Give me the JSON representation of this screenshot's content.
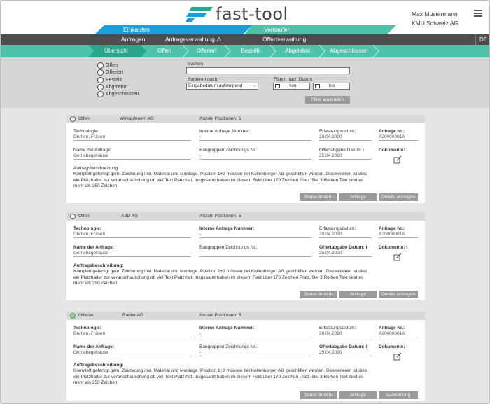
{
  "brand": {
    "logo_text": "fast-tool",
    "accent": "#2aa78b",
    "blue": "#1ba0dc"
  },
  "user": {
    "name": "Max Mustermann",
    "company": "KMU Schweiz AG"
  },
  "sections": {
    "einkaufen": "Einkaufen",
    "verkaufen": "Verkaufen",
    "anfragen": "Anfragen",
    "anfrageverwaltung": "Anfrageverwaltung",
    "offertverwaltung": "Offertverwaltung",
    "lang": "DE"
  },
  "steps": [
    "Übersicht",
    "Offen",
    "Offeriert",
    "Bestellt",
    "Abgelehnt",
    "Abgeschlossen"
  ],
  "filter": {
    "statuses": [
      "Offen",
      "Offeriert",
      "Bestellt",
      "Abgelehnt",
      "Abgeschlossen"
    ],
    "search_label": "Suchen",
    "sort_label": "Sortieren nach:",
    "sort_value": "Eingabedatum aufsteigend",
    "date_label": "Filtern nach Datum",
    "from_placeholder": "von",
    "to_placeholder": "bis",
    "apply_label": "Filter anwenden"
  },
  "labels": {
    "technologie": "Technologie:",
    "interne_nr": "Interne Anfrage Nummer:",
    "erfassungsdatum": "Erfassungsdatum:",
    "anfrage_nr": "Anfrage Nr.:",
    "name_anfrage": "Name der Anfrage:",
    "baugruppen": "Baugruppen Zeichnungs Nr.:",
    "offertabgabe": "Offertabgabe Datum:",
    "dokumente": "Dokumente:",
    "auftrag": "Auftragsbeschreibung:",
    "info": "i",
    "positionen": "Anzahl Positionen: 5",
    "status_btn": "Status ändern",
    "anfrage_btn": "Anfrage",
    "details_btn": "Details anzeigen",
    "auswertung_btn": "Auswertung"
  },
  "cards": [
    {
      "status": "Offen",
      "company": "Wirkaufenein AG",
      "technologie": "Drehen, Fräsen",
      "interne_nr": "-",
      "erfassungsdatum": "20.04.2020",
      "anfrage_nr": "A20000001A",
      "name_anfrage": "Getriebegehäuse",
      "baugruppen": "-",
      "offertabgabe": "25.04.2020",
      "description": "Komplett gefertigt gem. Zeichnung inkl. Material und Montage. Position 1+3 müssen bei Kellenberger AG geschliffen werden. Desweiteren ist dies ein Platzhalter zur veranschaulichung ob viel Text Platz hat. Insgesamt haben im diesem Feld über 170 Zeichen Platz. Bei 3 Reihen Text sind es mehr als 250 Zeichen"
    },
    {
      "status": "Offen",
      "company": "ABD AG",
      "technologie": "Drehen, Fräsen",
      "interne_nr": "-",
      "erfassungsdatum": "20.04.2020",
      "anfrage_nr": "A20000001A",
      "name_anfrage": "Getriebegehäuse",
      "baugruppen": "-",
      "offertabgabe": "25.04.2020",
      "description": "Komplett gefertigt gem. Zeichnung inkl. Material und Montage. Position 1+3 müssen bei Kellenberger AG geschliffen werden. Desweiteren ist dies ein Platzhalter zur veranschaulichung ob viel Text Platz hat. Insgesamt haben im diesem Feld über 170 Zeichen Platz. Bei 3 Reihen Text sind es mehr als 250 Zeichen"
    },
    {
      "status": "Offeriert",
      "company": "Radler AG",
      "technologie": "Drehen, Fräsen",
      "interne_nr": "-",
      "erfassungsdatum": "20.04.2020",
      "anfrage_nr": "A20000001A",
      "name_anfrage": "Getriebegehäuse",
      "baugruppen": "-",
      "offertabgabe": "25.04.2020",
      "description": "Komplett gefertigt gem. Zeichnung inkl. Material und Montage. Position 1+3 müssen bei Kellenberger AG geschliffen werden. Desweiteren ist dies ein Platzhalter zur veranschaulichung ob viel Text Platz hat. Insgesamt haben im diesem Feld über 170 Zeichen Platz. Bei 3 Reihen Text sind es mehr als 250 Zeichen"
    }
  ]
}
